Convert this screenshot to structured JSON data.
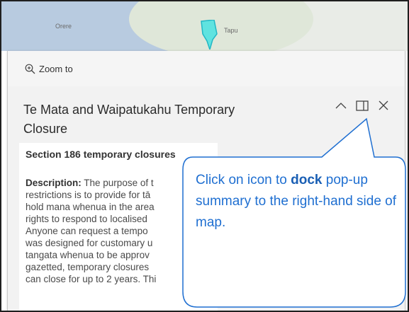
{
  "map": {
    "places": [
      "Orere",
      "Tapu"
    ]
  },
  "toolbar": {
    "zoom_label": "Zoom to"
  },
  "popup": {
    "title": "Te Mata and Waipatukahu Temporary Closure",
    "section": "Section 186 temporary closures",
    "description_label": "Description:",
    "description_lines": [
      "The purpose of t",
      "restrictions is to provide for tā",
      "hold mana whenua in the area",
      "rights to respond to localised",
      "Anyone can request a tempo",
      "was designed for customary u",
      "tangata whenua to be approv",
      "gazetted, temporary closures",
      "can close for up to 2 years. Thi"
    ]
  },
  "callout": {
    "text_before": "Click on icon to ",
    "text_bold": "dock",
    "text_after": " pop-up summary to the right-hand side of map.",
    "border_color": "#1f6fd1"
  }
}
